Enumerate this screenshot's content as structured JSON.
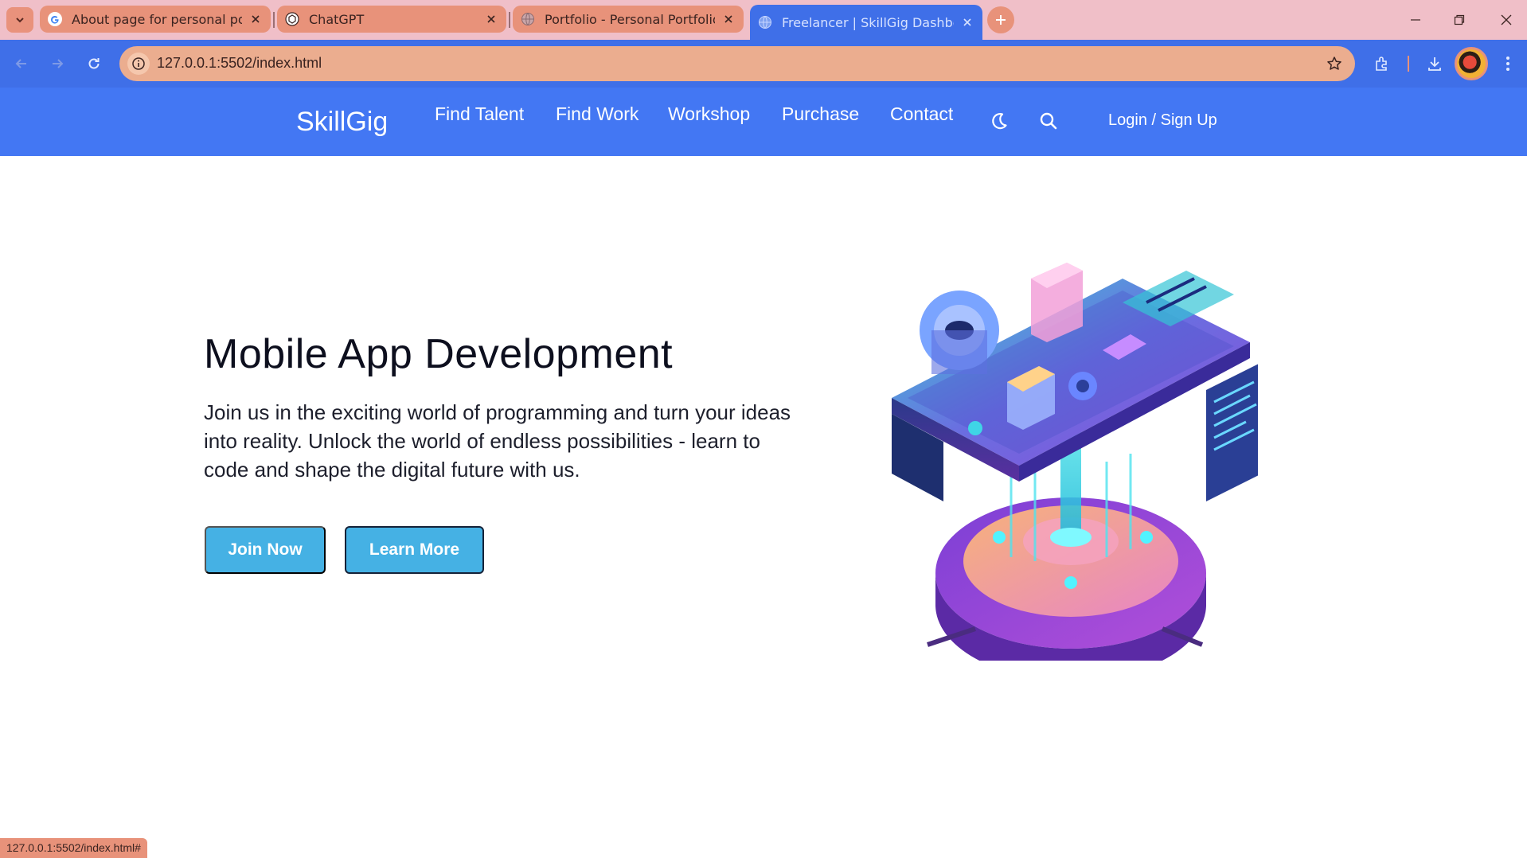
{
  "browser": {
    "tabs": [
      {
        "title": "About page for personal portfolio",
        "favicon": "google-g-icon",
        "active": false
      },
      {
        "title": "ChatGPT",
        "favicon": "chatgpt-icon",
        "active": false
      },
      {
        "title": "Portfolio - Personal Portfolio",
        "favicon": "globe-icon",
        "active": false
      },
      {
        "title": "Freelancer | SkillGig Dashboard",
        "favicon": "globe-icon",
        "active": true
      }
    ],
    "url": "127.0.0.1:5502/index.html",
    "status_url": "127.0.0.1:5502/index.html#",
    "colors": {
      "tabstrip": "#f0bfc8",
      "tab": "#e8927a",
      "toolbar": "#3f6fe8",
      "omnibox": "#ebad8f"
    }
  },
  "site": {
    "brand": "SkillGig",
    "nav": [
      "Find Talent",
      "Find Work",
      "Workshop",
      "Purchase",
      "Contact"
    ],
    "icons": [
      "moon-icon",
      "search-icon"
    ],
    "login": "Login / Sign Up",
    "header_color": "#4377f3"
  },
  "hero": {
    "title": "Mobile App Development",
    "text": "Join us in the exciting world of programming and turn your ideas into reality. Unlock the world of endless possibilities - learn to code and shape the digital future with us.",
    "primary_button": "Join Now",
    "secondary_button": "Learn More",
    "button_color": "#45b1e4"
  }
}
